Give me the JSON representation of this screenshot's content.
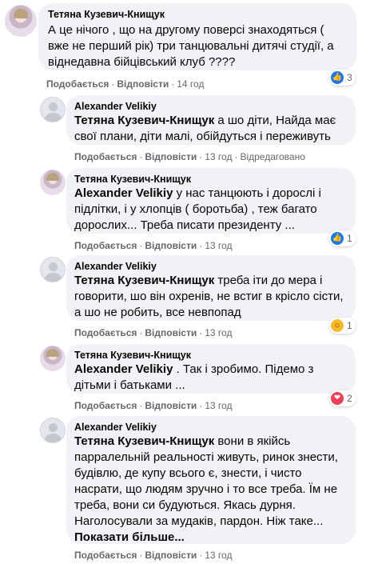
{
  "labels": {
    "like": "Подобається",
    "reply": "Відповісти",
    "edited": "Відредаговано",
    "show_more": "Показати більше..."
  },
  "comments": [
    {
      "author": "Тетяна Кузевич-Книщук",
      "text": "А це нічого , що на другому поверсі знаходяться ( вже не перший рік) три танцювальні дитячі студії, а віднедавна бійцівський клуб ????",
      "time": "14 год",
      "reaction": {
        "icon": "like-icon",
        "count": "3"
      }
    },
    {
      "author": "Alexander Velikiy",
      "mention": "Тетяна Кузевич-Книщук",
      "text": " а шо діти, Найда має свої плани, діти малі, обійдуться і переживуть",
      "time": "13 год",
      "edited": true
    },
    {
      "author": "Тетяна Кузевич-Книщук",
      "mention": "Alexander Velikiy",
      "text": " у нас танцюють і дорослі і підлітки, і у хлопців ( боротьба) , теж багато дорослих... Треба писати президенту ...",
      "time": "13 год",
      "reaction": {
        "icon": "like-icon",
        "count": "1"
      }
    },
    {
      "author": "Alexander Velikiy",
      "mention": "Тетяна Кузевич-Книщук",
      "text": " треба іти до мера і говорити, шо він охренів, не встиг в крісло сісти, а шо не робить, все невпопад",
      "time": "13 год",
      "reaction": {
        "icon": "wow-icon",
        "count": "1"
      }
    },
    {
      "author": "Тетяна Кузевич-Книщук",
      "mention": "Alexander Velikiy",
      "text": " . Так і зробимо. Підемо з дітьми і батьками ...",
      "time": "13 год",
      "reaction": {
        "icon": "love-icon",
        "count": "2"
      }
    },
    {
      "author": "Alexander Velikiy",
      "mention": "Тетяна Кузевич-Книщук",
      "text": " вони в якійсь парралельній реальності живуть, ринок знести, будівлю, де купу всього є, знести, і чисто насрати, що людям зручно і то все треба. Їм не треба, вони си будуються. Якась дурня. Наголосували за мудаків, пардон. Ніж таке...",
      "time": "13 год"
    }
  ],
  "colors": {
    "bubble": "#f0f2f5",
    "meta": "#65676b",
    "like": "#1877f2",
    "love": "#f33e58",
    "wow": "#f7b928"
  }
}
